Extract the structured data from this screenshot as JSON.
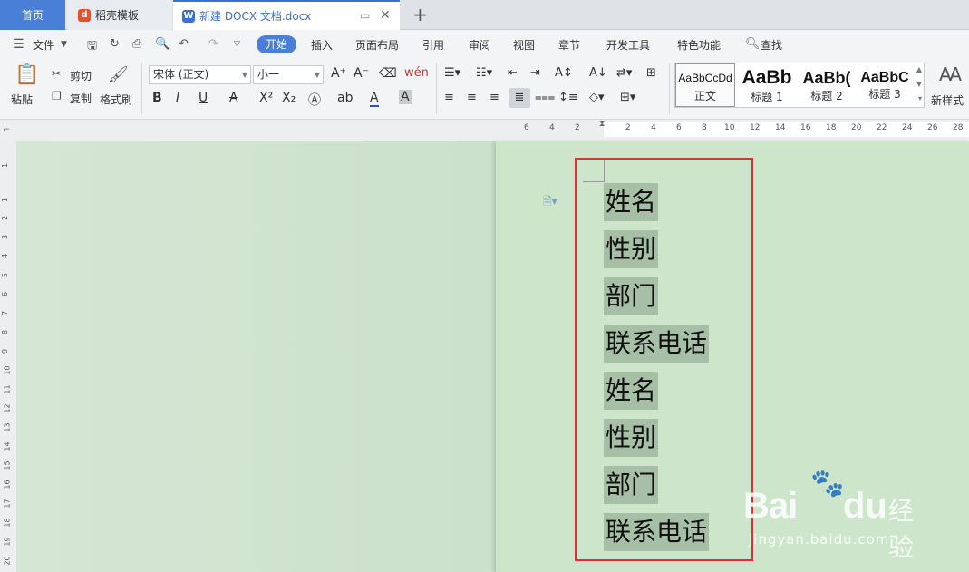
{
  "tabs": {
    "home": "首页",
    "template": "稻壳模板",
    "document": "新建 DOCX 文档.docx",
    "new_tab": "+"
  },
  "menu": {
    "file": "文件",
    "items": [
      "开始",
      "插入",
      "页面布局",
      "引用",
      "审阅",
      "视图",
      "章节",
      "开发工具",
      "特色功能"
    ],
    "search": "查找"
  },
  "ribbon": {
    "paste": "粘贴",
    "cut": "剪切",
    "copy": "复制",
    "format_painter": "格式刷",
    "font_name": "宋体 (正文)",
    "font_size": "小一",
    "new_style": "新样式",
    "styles": [
      {
        "preview": "AaBbCcDd",
        "label": "正文"
      },
      {
        "preview": "AaBb",
        "label": "标题 1"
      },
      {
        "preview": "AaBb(",
        "label": "标题 2"
      },
      {
        "preview": "AaBbC",
        "label": "标题 3"
      }
    ]
  },
  "ruler": {
    "h_ticks": [
      "6",
      "4",
      "2",
      "2",
      "4",
      "6",
      "8",
      "10",
      "12",
      "14",
      "16",
      "18",
      "20",
      "22",
      "24",
      "26",
      "28"
    ],
    "v_ticks": [
      "1",
      "1",
      "2",
      "3",
      "4",
      "5",
      "6",
      "7",
      "8",
      "9",
      "10",
      "11",
      "12",
      "13",
      "14",
      "15",
      "16",
      "17",
      "18",
      "19",
      "20"
    ]
  },
  "document": {
    "lines": [
      "姓名",
      "性别",
      "部门",
      "联系电话",
      "姓名",
      "性别",
      "部门",
      "联系电话"
    ]
  },
  "watermark": {
    "brand": "Bai",
    "brand2": "du",
    "cn": "经验",
    "url": "jingyan.baidu.com"
  },
  "colors": {
    "accent": "#4a7fd8",
    "selection": "#a7bfa6",
    "highlight_box": "#e03030",
    "page_bg": "#cde6cb"
  }
}
